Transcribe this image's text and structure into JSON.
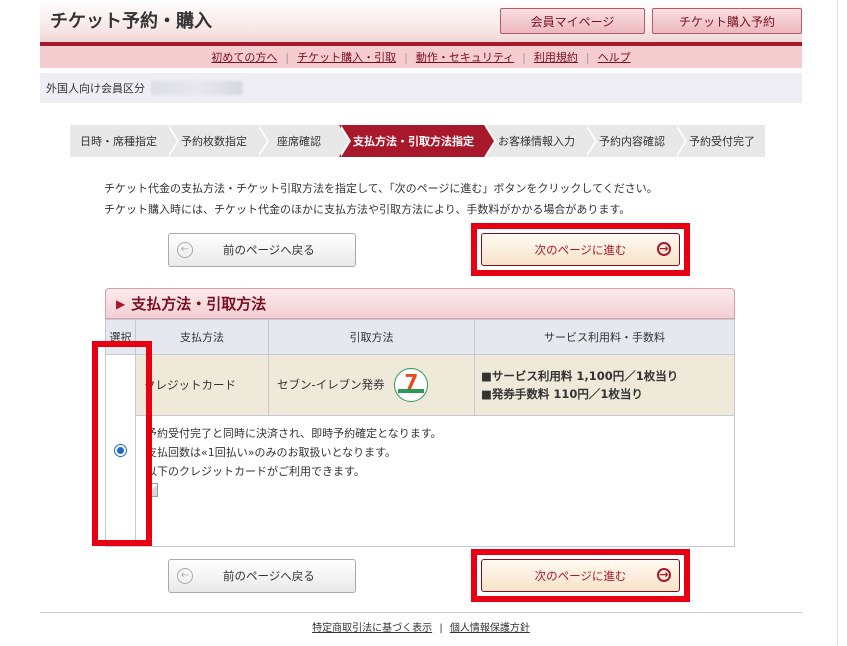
{
  "header": {
    "title": "チケット予約・購入",
    "member_button": "会員マイページ",
    "booking_button": "チケット購入予約"
  },
  "nav": {
    "items": [
      "初めての方へ",
      "チケット購入・引取",
      "動作・セキュリティ",
      "利用規約",
      "ヘルプ"
    ]
  },
  "member": {
    "label": "外国人向け会員区分"
  },
  "steps": [
    {
      "label": "日時・席種指定",
      "active": false
    },
    {
      "label": "予約枚数指定",
      "active": false
    },
    {
      "label": "座席確認",
      "active": false
    },
    {
      "label": "支払方法・引取方法指定",
      "active": true
    },
    {
      "label": "お客様情報入力",
      "active": false
    },
    {
      "label": "予約内容確認",
      "active": false
    },
    {
      "label": "予約受付完了",
      "active": false
    }
  ],
  "intro": {
    "line1": "チケット代金の支払方法・チケット引取方法を指定して、「次のページに進む」ボタンをクリックしてください。",
    "line2": "チケット購入時には、チケット代金のほかに支払方法や引取方法により、手数料がかかる場合があります。"
  },
  "buttons": {
    "prev": "前のページへ戻る",
    "next": "次のページに進む"
  },
  "section": {
    "title": "支払方法・引取方法"
  },
  "table": {
    "headers": [
      "選択",
      "支払方法",
      "引取方法",
      "サービス利用料・手数料"
    ],
    "row": {
      "payment": "クレジットカード",
      "pickup": "セブン-イレブン発券",
      "fee1": "■サービス利用料 1,100円／1枚当り",
      "fee2": "■発券手数料 110円／1枚当り",
      "detail1": "予約受付完了と同時に決済され、即時予約確定となります。",
      "detail2": "支払回数は«1回払い»のみのお取扱いとなります。",
      "detail3": "以下のクレジットカードがご利用できます。",
      "selected": true
    }
  },
  "footer": {
    "link1": "特定商取引法に基づく表示",
    "link2": "個人情報保護方針"
  },
  "colors": {
    "brand": "#a8182b",
    "highlight": "#e60012"
  },
  "icons": {
    "prev": "arrow-left-circle-icon",
    "next": "arrow-right-circle-icon",
    "step_arrow": "chevron-right-icon",
    "section": "triangle-right-icon",
    "store_logo": "seven-eleven-logo-icon",
    "card_image": "broken-image-icon"
  }
}
